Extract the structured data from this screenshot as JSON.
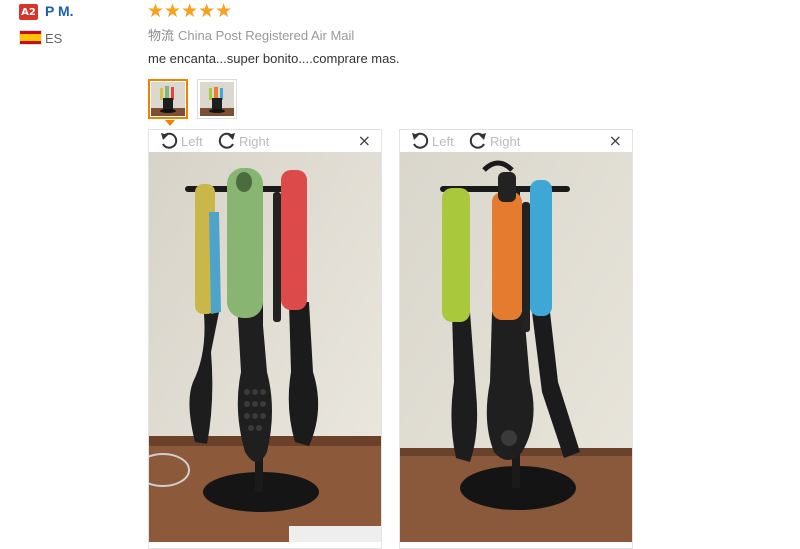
{
  "reviewer": {
    "badge": "A2",
    "name": "P M.",
    "country": "ES",
    "flag": "spain-flag"
  },
  "review": {
    "stars": "★★★★★",
    "rating": 5,
    "shipping_label": "物流",
    "shipping_method": "China Post Registered Air Mail",
    "comment": "me encanta...super bonito....comprare mas."
  },
  "thumbnails": [
    {
      "name": "photo-1",
      "active": true
    },
    {
      "name": "photo-2",
      "active": false
    }
  ],
  "viewer": {
    "rotate_left": "Left",
    "rotate_right": "Right",
    "close": "×"
  },
  "colors": {
    "badge": "#d9342b",
    "name": "#1b5fb2",
    "stars": "#f7a21d",
    "active_thumb": "#f08200"
  }
}
